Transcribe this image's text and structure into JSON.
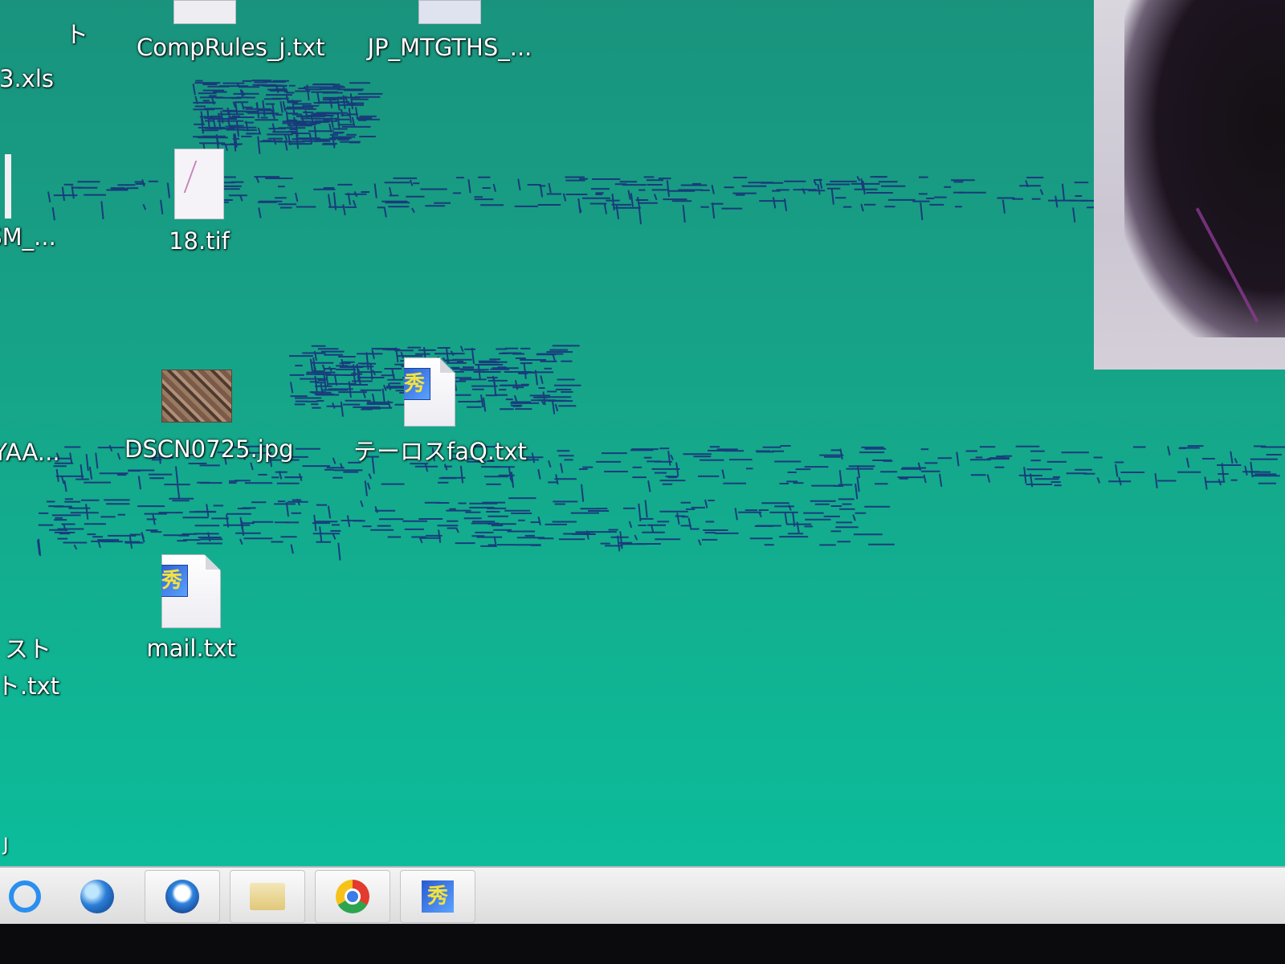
{
  "desktop": {
    "icons": [
      {
        "label": "CompRules_j.txt"
      },
      {
        "label": "JP_MTGTHS_..."
      },
      {
        "label": "18.tif"
      },
      {
        "label": "DSCN0725.jpg"
      },
      {
        "label": "テーロスfaQ.txt"
      },
      {
        "label": "mail.txt"
      }
    ],
    "cut_labels": [
      {
        "label": "ト"
      },
      {
        "label": "3.xls"
      },
      {
        "label": "SM_..."
      },
      {
        "label": "YAA..."
      },
      {
        "label": "スト"
      },
      {
        "label": "ト.txt"
      }
    ],
    "edge_glyph": "J"
  },
  "taskbar": {
    "apps": [
      {
        "name": "internet-explorer-icon"
      },
      {
        "name": "globe-icon"
      },
      {
        "name": "mail-globe-icon"
      },
      {
        "name": "folder-icon"
      },
      {
        "name": "chrome-icon"
      },
      {
        "name": "hidemaru-editor-icon"
      }
    ],
    "hidemaru_glyph": "秀"
  },
  "colors": {
    "desktop_background": "#16a589",
    "taskbar_background": "#e6e6e6",
    "label_text": "#ffffff"
  }
}
